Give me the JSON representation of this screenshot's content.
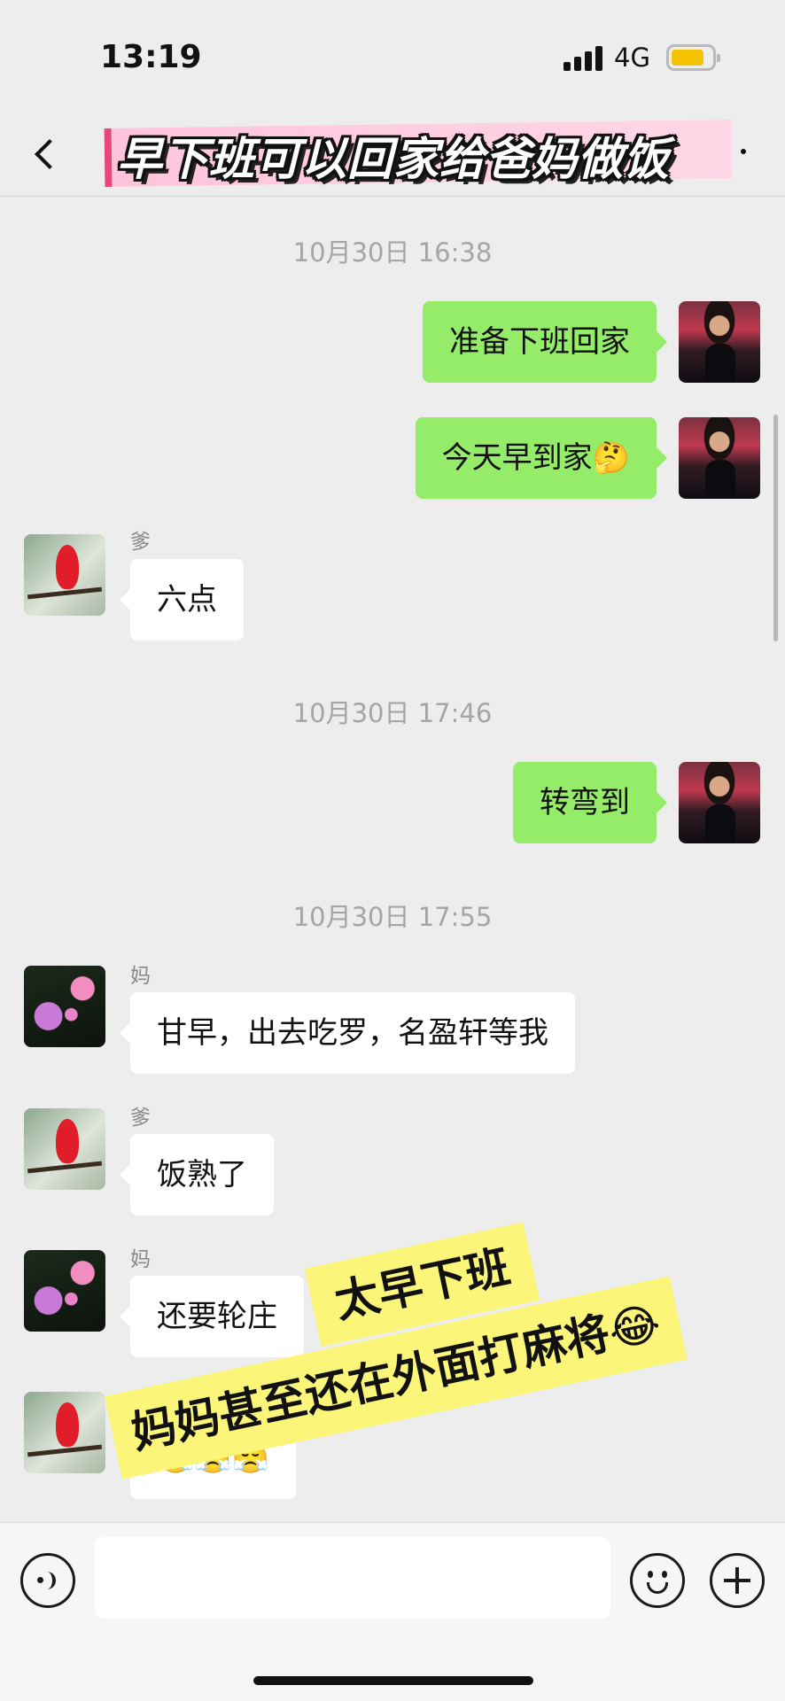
{
  "status_bar": {
    "time": "13:19",
    "network": "4G"
  },
  "nav": {
    "title": "早下班可以回家给爸妈做饭"
  },
  "timestamps": [
    "10月30日 16:38",
    "10月30日 17:46",
    "10月30日 17:55"
  ],
  "messages": {
    "m1": "准备下班回家",
    "m2": "今天早到家🤔",
    "m3_sender": "爹",
    "m3": "六点",
    "m4": "转弯到",
    "m5_sender": "妈",
    "m5": "甘早，出去吃罗，名盈轩等我",
    "m6_sender": "爹",
    "m6": "饭熟了",
    "m7_sender": "妈",
    "m7": "还要轮庄",
    "m8_sender": "爹",
    "m8": "😤😤😤"
  },
  "overlay": {
    "line1": "太早下班",
    "line2": "妈妈甚至还在外面打麻将😂"
  },
  "colors": {
    "outgoing_bubble": "#95ec69",
    "incoming_bubble": "#ffffff",
    "background": "#ededed",
    "highlight": "#fbf67a",
    "title_banner": "#ffc4dc"
  },
  "icons": [
    "back-icon",
    "voice-icon",
    "emoji-icon",
    "plus-icon"
  ]
}
